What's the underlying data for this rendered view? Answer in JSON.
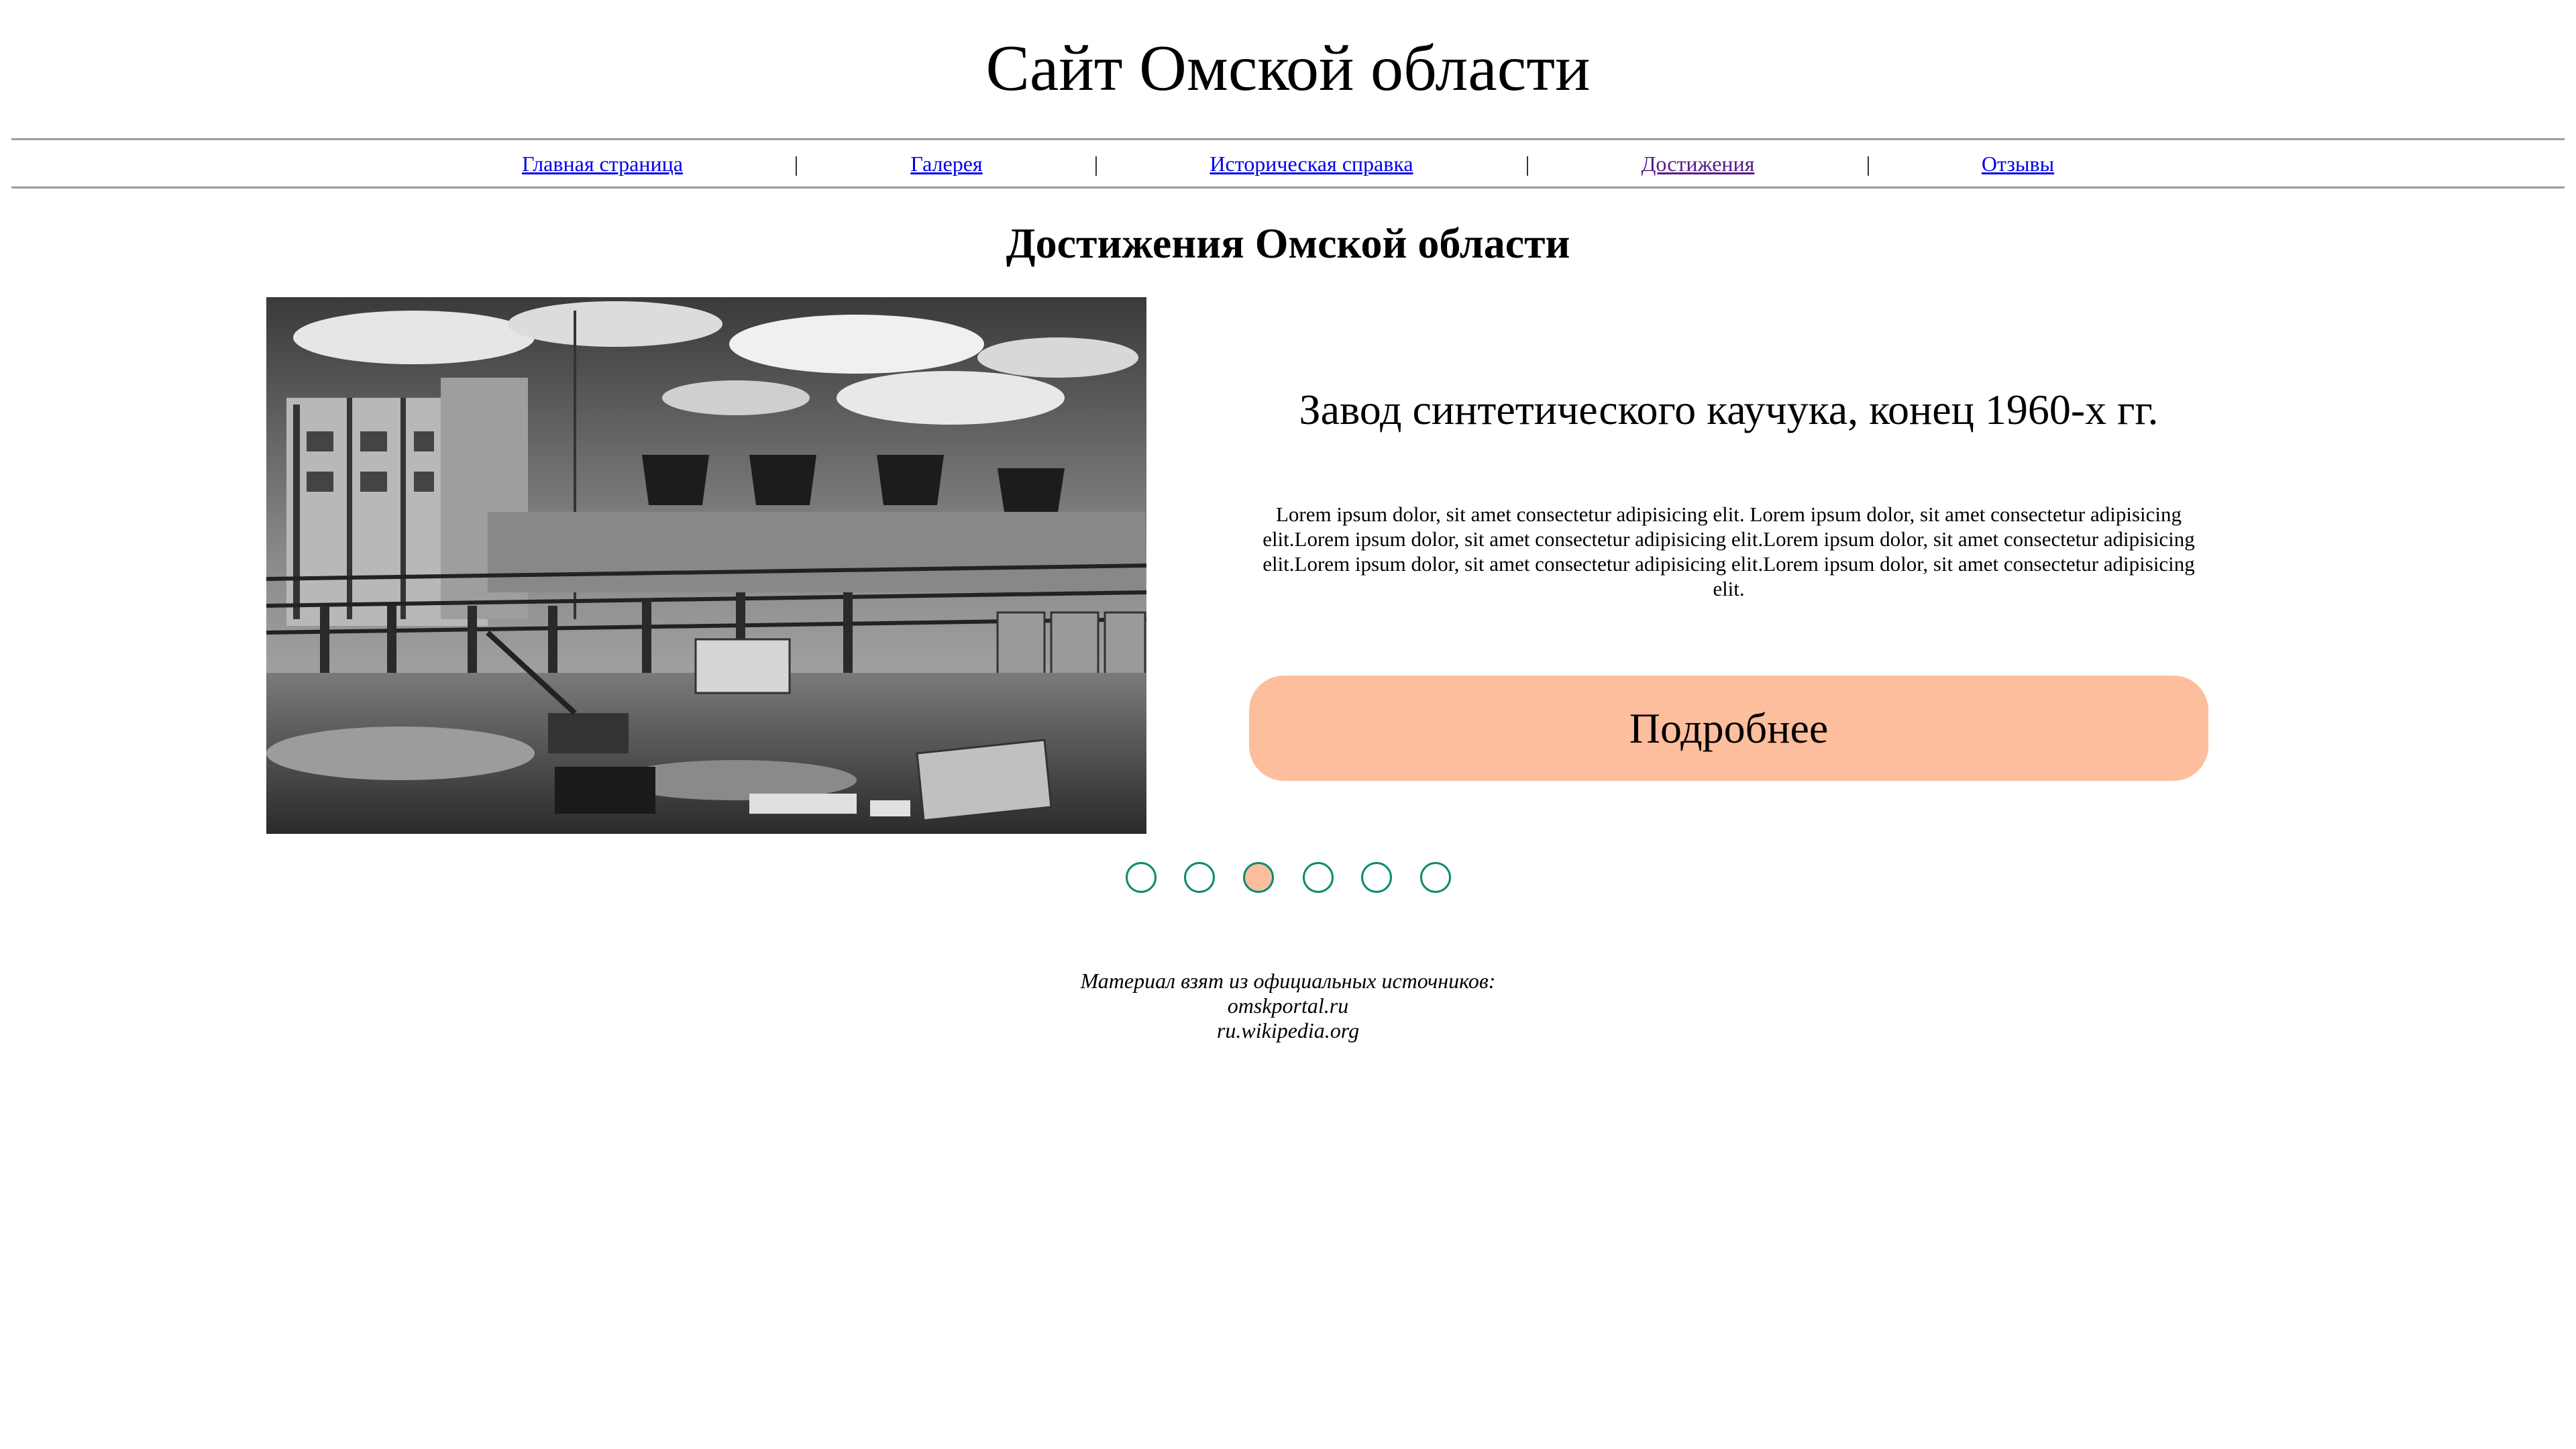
{
  "header": {
    "title": "Сайт Омской области"
  },
  "nav": {
    "items": [
      {
        "label": "Главная страница",
        "state": "unvisited"
      },
      {
        "label": "Галерея",
        "state": "unvisited"
      },
      {
        "label": "Историческая справка",
        "state": "unvisited"
      },
      {
        "label": "Достижения",
        "state": "visited"
      },
      {
        "label": "Отзывы",
        "state": "unvisited"
      }
    ],
    "separator": "|"
  },
  "main": {
    "heading": "Достижения Омской области",
    "slide": {
      "image_description_icon": "factory-photo",
      "caption": "Завод синтетического каучука, конец 1960-х гг.",
      "text": "Lorem ipsum dolor, sit amet consectetur adipisicing elit. Lorem ipsum dolor, sit amet consectetur adipisicing elit.Lorem ipsum dolor, sit amet consectetur adipisicing elit.Lorem ipsum dolor, sit amet consectetur adipisicing elit.Lorem ipsum dolor, sit amet consectetur adipisicing elit.Lorem ipsum dolor, sit amet consectetur adipisicing elit.",
      "button_label": "Подробнее"
    },
    "carousel": {
      "total": 6,
      "active_index": 2
    }
  },
  "footer": {
    "lines": [
      "Материал взят из официальных источников:",
      "omskportal.ru",
      "ru.wikipedia.org"
    ]
  },
  "colors": {
    "accent": "#fdbe9d",
    "dot_border": "#0b8a6e",
    "link": "#0000ee",
    "visited_link": "#551a8b"
  }
}
